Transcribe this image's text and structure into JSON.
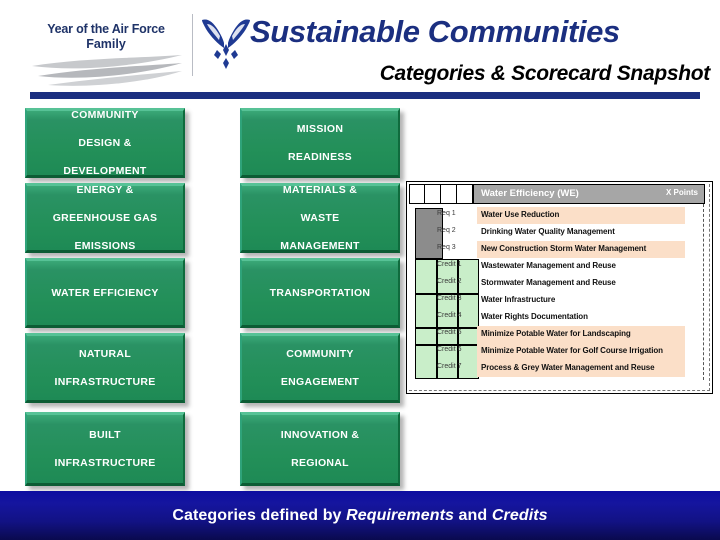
{
  "header": {
    "logo_line1": "Year of the Air Force",
    "logo_line2": "Family",
    "title": "Sustainable Communities",
    "subtitle": "Categories & Scorecard Snapshot",
    "accent_color": "#1b2f80"
  },
  "categories": {
    "box_color": "#2a9465",
    "items": [
      {
        "id": "community-design-development",
        "lines": [
          "COMMUNITY",
          "DESIGN &",
          "DEVELOPMENT"
        ]
      },
      {
        "id": "mission-readiness",
        "lines": [
          "MISSION",
          "READINESS"
        ]
      },
      {
        "id": "energy-greenhouse-gas",
        "lines": [
          "ENERGY &",
          "GREENHOUSE GAS",
          "EMISSIONS"
        ]
      },
      {
        "id": "materials-waste-management",
        "lines": [
          "MATERIALS &",
          "WASTE",
          "MANAGEMENT"
        ]
      },
      {
        "id": "water-efficiency",
        "lines": [
          "WATER EFFICIENCY"
        ]
      },
      {
        "id": "transportation",
        "lines": [
          "TRANSPORTATION"
        ]
      },
      {
        "id": "natural-infrastructure",
        "lines": [
          "NATURAL",
          "INFRASTRUCTURE"
        ]
      },
      {
        "id": "community-engagement",
        "lines": [
          "COMMUNITY",
          "ENGAGEMENT"
        ]
      },
      {
        "id": "built-infrastructure",
        "lines": [
          "BUILT",
          "INFRASTRUCTURE"
        ]
      },
      {
        "id": "innovation-regional",
        "lines": [
          "INNOVATION &",
          "REGIONAL"
        ]
      }
    ]
  },
  "scorecard": {
    "title": "Water Efficiency (WE)",
    "points_header": "X Points",
    "header_bg": "#a6a6a6",
    "highlight_color": "#fbdfc8",
    "credit_cell_color": "#c9eec9",
    "requirement_cell_color": "#8c8c8c",
    "rows": [
      {
        "label": "Req 1",
        "text": "Water Use Reduction",
        "highlight": true
      },
      {
        "label": "Req 2",
        "text": "Drinking Water Quality Management",
        "highlight": false
      },
      {
        "label": "Req 3",
        "text": "New Construction Storm Water Management",
        "highlight": true
      },
      {
        "label": "Credit 1",
        "text": "Wastewater Management and Reuse",
        "highlight": false
      },
      {
        "label": "Credit 2",
        "text": "Stormwater Management and Reuse",
        "highlight": false
      },
      {
        "label": "Credit 3",
        "text": "Water Infrastructure",
        "highlight": false
      },
      {
        "label": "Credit 4",
        "text": "Water Rights Documentation",
        "highlight": false
      },
      {
        "label": "Credit 5",
        "text": "Minimize Potable Water for Landscaping",
        "highlight": true
      },
      {
        "label": "Credit 6",
        "text": "Minimize Potable Water for Golf Course Irrigation",
        "highlight": true
      },
      {
        "label": "Credit 7",
        "text": "Process & Grey Water Management and Reuse",
        "highlight": true
      }
    ]
  },
  "footer": {
    "text_before": "Categories defined by ",
    "emphasis_1": "Requirements",
    "text_middle": " and ",
    "emphasis_2": "Credits",
    "bg_color": "#12128c"
  }
}
